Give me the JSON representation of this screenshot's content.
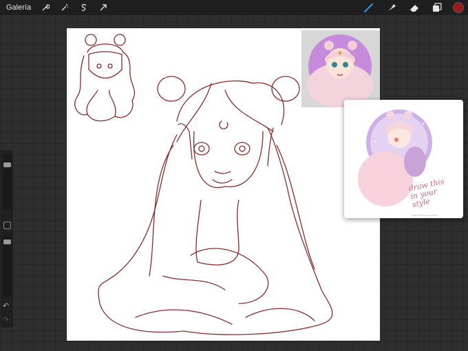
{
  "topbar": {
    "gallery_label": "Galería",
    "left_tools": [
      "wrench-icon",
      "magic-wand-icon",
      "selection-icon",
      "transform-arrow-icon"
    ],
    "right_tools": [
      "brush-icon",
      "smudge-icon",
      "eraser-icon",
      "layers-icon"
    ],
    "current_color": "#9a1c1c"
  },
  "sidebar": {
    "brush_size": 0.2,
    "opacity": 0.8,
    "undo_icon": "↶",
    "redo_icon": "↷"
  },
  "reference_2": {
    "text": "draw this\nin your\nstyle",
    "handle": "@drawthisinyourstyle"
  }
}
